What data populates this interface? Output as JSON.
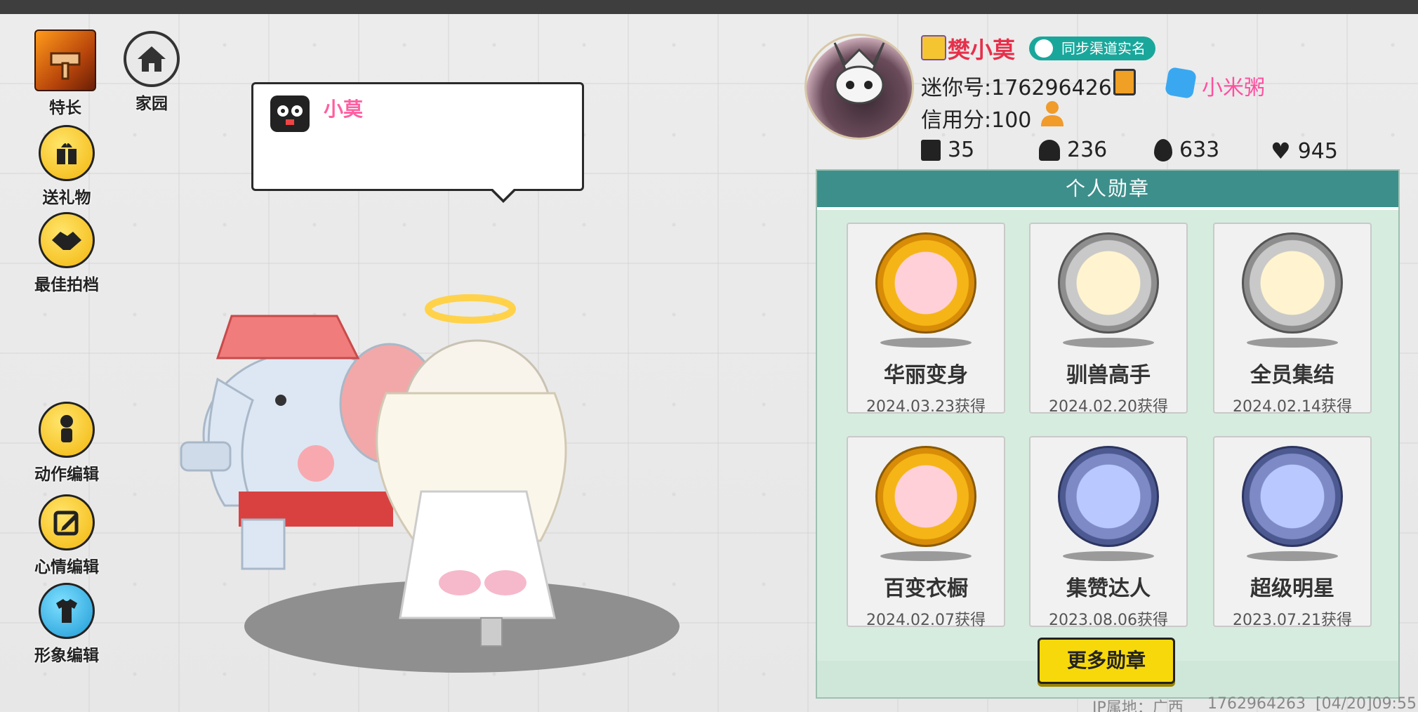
{
  "left_menu": {
    "specialty": "特长",
    "home": "家园",
    "gift": "送礼物",
    "best_partner": "最佳拍档",
    "action_edit": "动作编辑",
    "mood_edit": "心情编辑",
    "image_edit": "形象编辑"
  },
  "bubble": {
    "name": "小莫"
  },
  "profile": {
    "nickname": "樊小莫",
    "sync_badge": "同步渠道实名",
    "mini_id": "迷你号:1762964263",
    "credit": "信用分:100",
    "partner_name": "小米粥",
    "stats": {
      "posts": "35",
      "fans": "236",
      "hot": "633",
      "likes": "945"
    }
  },
  "medals": {
    "title": "个人勋章",
    "items": [
      {
        "name": "华丽变身",
        "date": "2024.03.23获得",
        "style": "gold"
      },
      {
        "name": "驯兽高手",
        "date": "2024.02.20获得",
        "style": "silver"
      },
      {
        "name": "全员集结",
        "date": "2024.02.14获得",
        "style": "silver"
      },
      {
        "name": "百变衣橱",
        "date": "2024.02.07获得",
        "style": "gold"
      },
      {
        "name": "集赞达人",
        "date": "2023.08.06获得",
        "style": "blue"
      },
      {
        "name": "超级明星",
        "date": "2023.07.21获得",
        "style": "blue"
      }
    ],
    "more_button": "更多勋章"
  },
  "footer": {
    "ip": "IP属地：广西",
    "uid": "1762964263",
    "time": "[04/20]09:55"
  }
}
